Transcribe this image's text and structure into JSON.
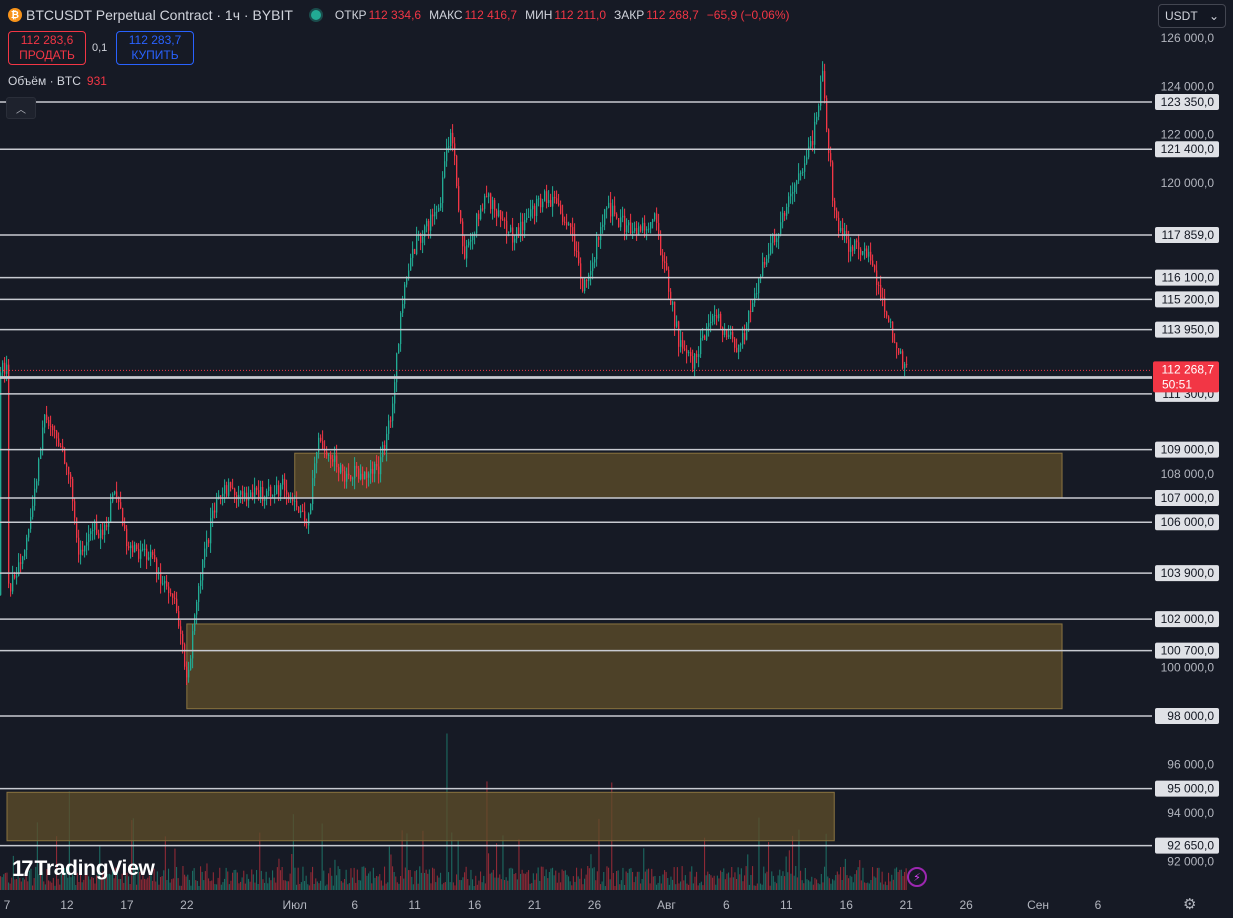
{
  "header": {
    "title": "BTCUSDT Perpetual Contract · 1ч · BYBIT",
    "open_label": "ОТКР",
    "open_value": "112 334,6",
    "high_label": "МАКС",
    "high_value": "112 416,7",
    "low_label": "МИН",
    "low_value": "112 211,0",
    "close_label": "ЗАКР",
    "close_value": "112 268,7",
    "change": "−65,9 (−0,06%)"
  },
  "trade": {
    "sell_price": "112 283,6",
    "sell_label": "ПРОДАТЬ",
    "spread": "0,1",
    "buy_price": "112 283,7",
    "buy_label": "КУПИТЬ"
  },
  "volume_legend": {
    "label": "Объём · BTC",
    "value": "931"
  },
  "currency_select": "USDT",
  "logo_text": "TradingView",
  "colors": {
    "background": "#161a25",
    "up": "#22ab94",
    "down": "#f23645",
    "zone_fill": "#5d4d29",
    "level_line": "#c8cad1"
  },
  "chart_data": {
    "type": "candlestick",
    "timeframe": "1ч",
    "last_price": "112 268,7",
    "countdown": "50:51",
    "y_range": [
      91500,
      126500
    ],
    "y_ticks": [
      {
        "value": 126000,
        "label": "126 000,0"
      },
      {
        "value": 124000,
        "label": "124 000,0"
      },
      {
        "value": 122000,
        "label": "122 000,0"
      },
      {
        "value": 120000,
        "label": "120 000,0"
      },
      {
        "value": 108000,
        "label": "108 000,0"
      },
      {
        "value": 100000,
        "label": "100 000,0"
      },
      {
        "value": 96000,
        "label": "96 000,0"
      },
      {
        "value": 94000,
        "label": "94 000,0"
      },
      {
        "value": 92000,
        "label": "92 000,0"
      }
    ],
    "horizontal_levels": [
      {
        "value": 123350,
        "label": "123 350,0"
      },
      {
        "value": 121400,
        "label": "121 400,0"
      },
      {
        "value": 117859,
        "label": "117 859,0"
      },
      {
        "value": 116100,
        "label": "116 100,0"
      },
      {
        "value": 115200,
        "label": "115 200,0"
      },
      {
        "value": 113950,
        "label": "113 950,0"
      },
      {
        "value": 111950,
        "label": ""
      },
      {
        "value": 111300,
        "label": "111 300,0"
      },
      {
        "value": 112000,
        "label": "112 000,0"
      },
      {
        "value": 109000,
        "label": "109 000,0"
      },
      {
        "value": 107000,
        "label": "107 000,0"
      },
      {
        "value": 106000,
        "label": "106 000,0"
      },
      {
        "value": 103900,
        "label": "103 900,0"
      },
      {
        "value": 102000,
        "label": "102 000,0"
      },
      {
        "value": 100700,
        "label": "100 700,0"
      },
      {
        "value": 98000,
        "label": "98 000,0"
      },
      {
        "value": 95000,
        "label": "95 000,0"
      },
      {
        "value": 92650,
        "label": "92 650,0"
      }
    ],
    "zones": [
      {
        "from_date": "2025-07-01",
        "to_date": "2025-09-03",
        "low": 107000,
        "high": 108850
      },
      {
        "from_date": "2025-06-22",
        "to_date": "2025-09-03",
        "low": 98300,
        "high": 101800
      },
      {
        "from_date": "2025-06-07",
        "to_date": "2025-08-15",
        "low": 92850,
        "high": 94850
      }
    ],
    "x_ticks": [
      {
        "date": "2025-06-07",
        "label": "7"
      },
      {
        "date": "2025-06-12",
        "label": "12"
      },
      {
        "date": "2025-06-17",
        "label": "17"
      },
      {
        "date": "2025-06-22",
        "label": "22"
      },
      {
        "date": "2025-07-01",
        "label": "Июл"
      },
      {
        "date": "2025-07-06",
        "label": "6"
      },
      {
        "date": "2025-07-11",
        "label": "11"
      },
      {
        "date": "2025-07-16",
        "label": "16"
      },
      {
        "date": "2025-07-21",
        "label": "21"
      },
      {
        "date": "2025-07-26",
        "label": "26"
      },
      {
        "date": "2025-08-01",
        "label": "Авг"
      },
      {
        "date": "2025-08-06",
        "label": "6"
      },
      {
        "date": "2025-08-11",
        "label": "11"
      },
      {
        "date": "2025-08-16",
        "label": "16"
      },
      {
        "date": "2025-08-21",
        "label": "21"
      },
      {
        "date": "2025-08-26",
        "label": "26"
      },
      {
        "date": "2025-09-01",
        "label": "Сен"
      },
      {
        "date": "2025-09-06",
        "label": "6"
      }
    ],
    "price_path": [
      {
        "date": "2025-06-07",
        "close": 103000
      },
      {
        "date": "2025-06-09",
        "close": 106000
      },
      {
        "date": "2025-06-10",
        "close": 110300
      },
      {
        "date": "2025-06-11",
        "close": 109500
      },
      {
        "date": "2025-06-12",
        "close": 108500
      },
      {
        "date": "2025-06-13",
        "close": 104500
      },
      {
        "date": "2025-06-14",
        "close": 105800
      },
      {
        "date": "2025-06-15",
        "close": 105500
      },
      {
        "date": "2025-06-16",
        "close": 107500
      },
      {
        "date": "2025-06-17",
        "close": 105000
      },
      {
        "date": "2025-06-18",
        "close": 104800
      },
      {
        "date": "2025-06-19",
        "close": 104600
      },
      {
        "date": "2025-06-20",
        "close": 103500
      },
      {
        "date": "2025-06-21",
        "close": 102500
      },
      {
        "date": "2025-06-22",
        "close": 99500
      },
      {
        "date": "2025-06-23",
        "close": 103500
      },
      {
        "date": "2025-06-24",
        "close": 106000
      },
      {
        "date": "2025-06-25",
        "close": 107500
      },
      {
        "date": "2025-06-27",
        "close": 107000
      },
      {
        "date": "2025-06-30",
        "close": 107500
      },
      {
        "date": "2025-07-02",
        "close": 106000
      },
      {
        "date": "2025-07-03",
        "close": 109500
      },
      {
        "date": "2025-07-05",
        "close": 108000
      },
      {
        "date": "2025-07-08",
        "close": 108200
      },
      {
        "date": "2025-07-09",
        "close": 110500
      },
      {
        "date": "2025-07-10",
        "close": 115500
      },
      {
        "date": "2025-07-11",
        "close": 117500
      },
      {
        "date": "2025-07-13",
        "close": 119000
      },
      {
        "date": "2025-07-14",
        "close": 122500
      },
      {
        "date": "2025-07-15",
        "close": 117000
      },
      {
        "date": "2025-07-17",
        "close": 119500
      },
      {
        "date": "2025-07-19",
        "close": 117800
      },
      {
        "date": "2025-07-22",
        "close": 119500
      },
      {
        "date": "2025-07-24",
        "close": 118000
      },
      {
        "date": "2025-07-25",
        "close": 115500
      },
      {
        "date": "2025-07-27",
        "close": 119000
      },
      {
        "date": "2025-07-29",
        "close": 118000
      },
      {
        "date": "2025-07-31",
        "close": 118500
      },
      {
        "date": "2025-08-02",
        "close": 113500
      },
      {
        "date": "2025-08-03",
        "close": 112500
      },
      {
        "date": "2025-08-05",
        "close": 114500
      },
      {
        "date": "2025-08-07",
        "close": 113000
      },
      {
        "date": "2025-08-09",
        "close": 116500
      },
      {
        "date": "2025-08-11",
        "close": 119000
      },
      {
        "date": "2025-08-13",
        "close": 121500
      },
      {
        "date": "2025-08-14",
        "close": 124400
      },
      {
        "date": "2025-08-15",
        "close": 118500
      },
      {
        "date": "2025-08-16",
        "close": 117500
      },
      {
        "date": "2025-08-18",
        "close": 117000
      },
      {
        "date": "2025-08-19",
        "close": 115000
      },
      {
        "date": "2025-08-20",
        "close": 113500
      },
      {
        "date": "2025-08-21",
        "close": 112268.7
      }
    ]
  }
}
